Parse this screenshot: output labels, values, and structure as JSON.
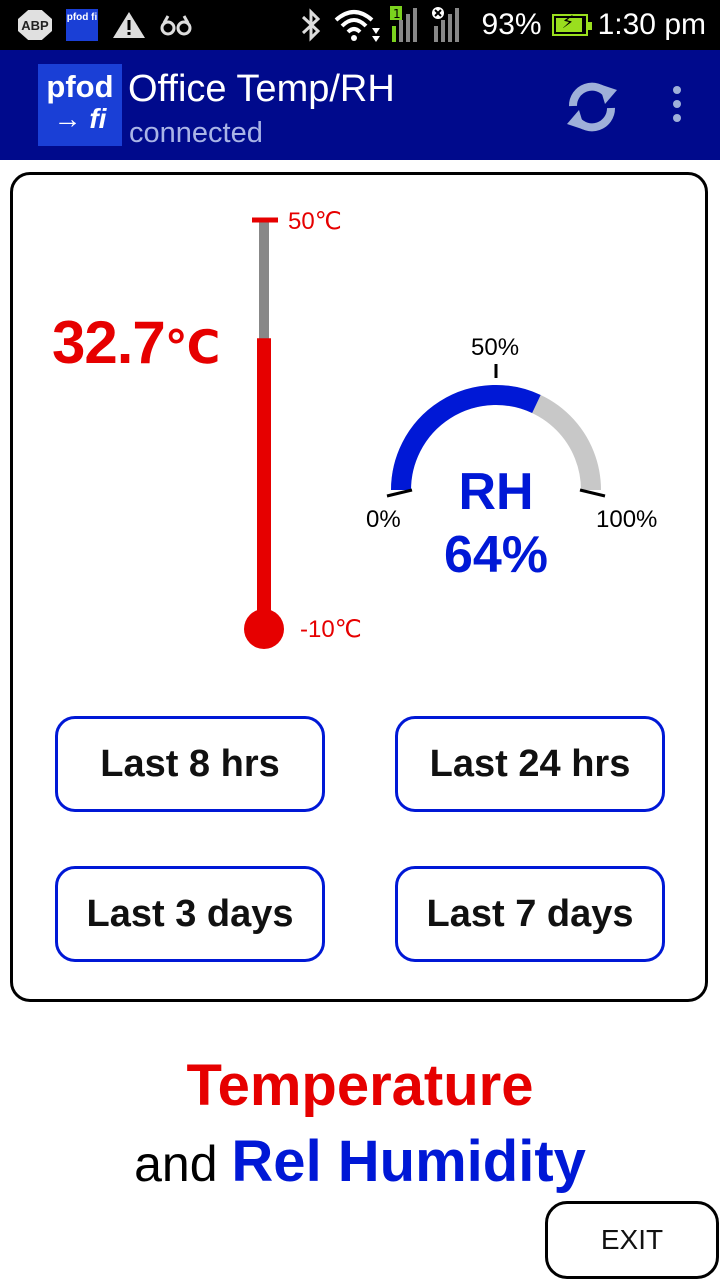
{
  "status_bar": {
    "abp_label": "ABP",
    "app_icon_label": "pfod fi",
    "signal_sim": "1",
    "battery_percent": "93%",
    "battery_level": 0.93,
    "time": "1:30 pm"
  },
  "app_bar": {
    "logo_line1": "pfod",
    "logo_line2": "→ fi",
    "title": "Office Temp/RH",
    "subtitle": "connected",
    "refresh_icon": "refresh-icon",
    "menu_icon": "overflow-menu-icon"
  },
  "colors": {
    "header": "#000a8c",
    "temp": "#e60000",
    "humidity": "#0018d6",
    "gauge_track": "#c8c8c8"
  },
  "temperature": {
    "value": "32.7",
    "unit": "℃",
    "numeric": 32.7,
    "max_label": "50℃",
    "min_label": "-10℃",
    "min": -10,
    "max": 50
  },
  "humidity": {
    "label": "RH",
    "value": "64%",
    "numeric": 64,
    "min_label": "0%",
    "mid_label": "50%",
    "max_label": "100%"
  },
  "buttons": {
    "last_8_hrs": "Last 8 hrs",
    "last_24_hrs": "Last 24 hrs",
    "last_3_days": "Last 3 days",
    "last_7_days": "Last 7 days"
  },
  "caption": {
    "line1": "Temperature",
    "line2_prefix": "and",
    "line2_highlight": "Rel Humidity"
  },
  "exit_label": "EXIT"
}
